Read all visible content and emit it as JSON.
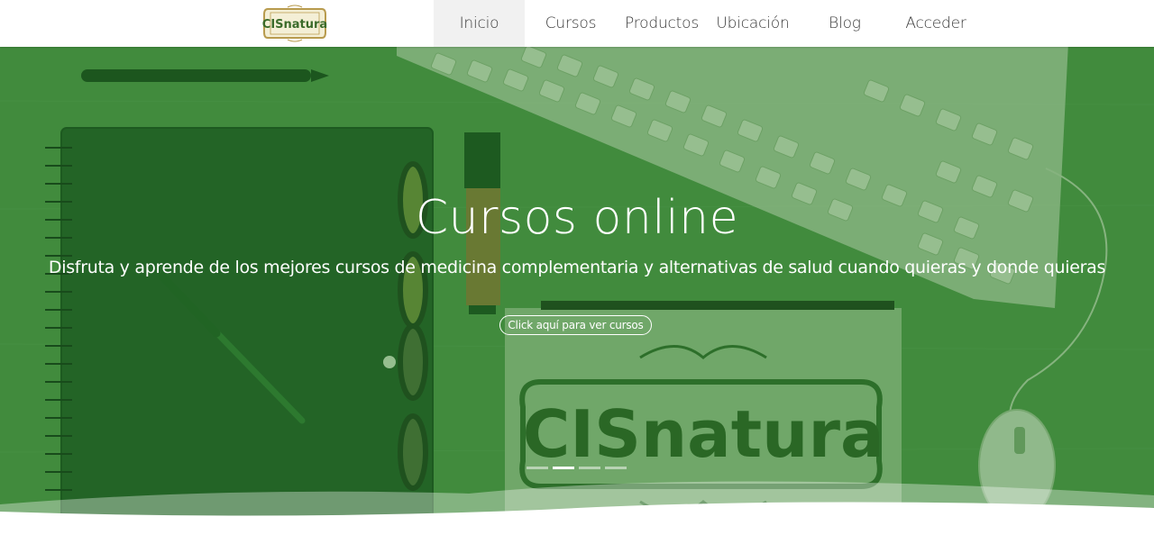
{
  "nav": {
    "logo_text": "CISnatura",
    "items": [
      {
        "label": "Inicio",
        "active": true
      },
      {
        "label": "Cursos",
        "active": false
      },
      {
        "label": "Productos",
        "active": false
      },
      {
        "label": "Ubicación",
        "active": false
      },
      {
        "label": "Blog",
        "active": false
      },
      {
        "label": "Acceder",
        "active": false
      }
    ]
  },
  "hero": {
    "title": "Cursos online",
    "subtitle": "Disfruta y aprende de los mejores cursos de medicina complementaria y alternativas de salud cuando quieras y donde quieras",
    "cta_label": "Click aquí para ver cursos",
    "sign_text": "CISnatura",
    "slides_total": 4,
    "active_slide": 2
  },
  "colors": {
    "overlay_green": "#3f8a3c",
    "logo_gold": "#b89b4e",
    "logo_green": "#3b6b2a"
  }
}
